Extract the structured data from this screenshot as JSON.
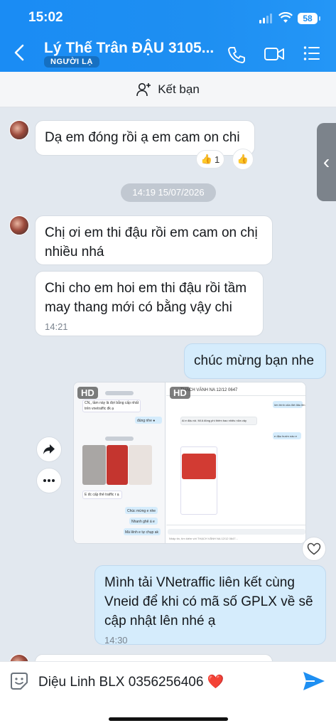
{
  "status_bar": {
    "time": "15:02",
    "battery": "58"
  },
  "header": {
    "contact_name": "Lý Thế Trân ĐẬU 3105...",
    "contact_tag": "NGƯỜI LẠ"
  },
  "add_friend": {
    "label": "Kết bạn"
  },
  "messages": [
    {
      "text": "Dạ em  đóng rồi ạ em cam on chi",
      "reaction_count": "1"
    },
    {
      "text": "Chị ơi em thi đậu rồi em cam on chị nhiều nhá"
    },
    {
      "text": "Chi cho em hoi em thi đậu rồi tầm may thang mới có bằng vậy chi",
      "time": "14:21"
    },
    {
      "text": "chúc mừng bạn nhe"
    },
    {
      "text": "Mình tải VNetraffic liên kết cùng Vneid để khi có mã số GPLX về sẽ cập nhật lên nhé ạ",
      "time": "14:30"
    }
  ],
  "date_separator": "14:19 15/07/2026",
  "image_badges": [
    "HD",
    "HD"
  ],
  "screenshot_left": {
    "line1": "CN,, tầm này là đợi bằng cấp nhất",
    "line2": "trên vnetraffic đk ạ",
    "reply1": "đúng nhe ●",
    "line3": "E đc cấp thẻ traffic r ạ",
    "reply2": "Chúc mừng e nhe",
    "reply3": "Nhanh ghê á e",
    "reply4": "Mà lênh e tự chụp ak"
  },
  "screenshot_right": {
    "title": "THẠCH VĂNH NA 12/12 0647",
    "msg1": "lớn trình của đới đấu lên",
    "msg2": "Ai e đậu rồi. Mi A đóng phí thêm bao nhiêu nữa vậy",
    "msg3": "e đậu hướn nào e",
    "footer": "Nhập tin, tìm kiếm với THẠCH VĂNH NA 12/12 0647..."
  },
  "input": {
    "draft": "Diệu Linh BLX 0356256406 ❤️"
  },
  "colors": {
    "header": "#1e8ff2",
    "mine_bubble": "#d5ecfc",
    "send": "#1e8ff2"
  }
}
